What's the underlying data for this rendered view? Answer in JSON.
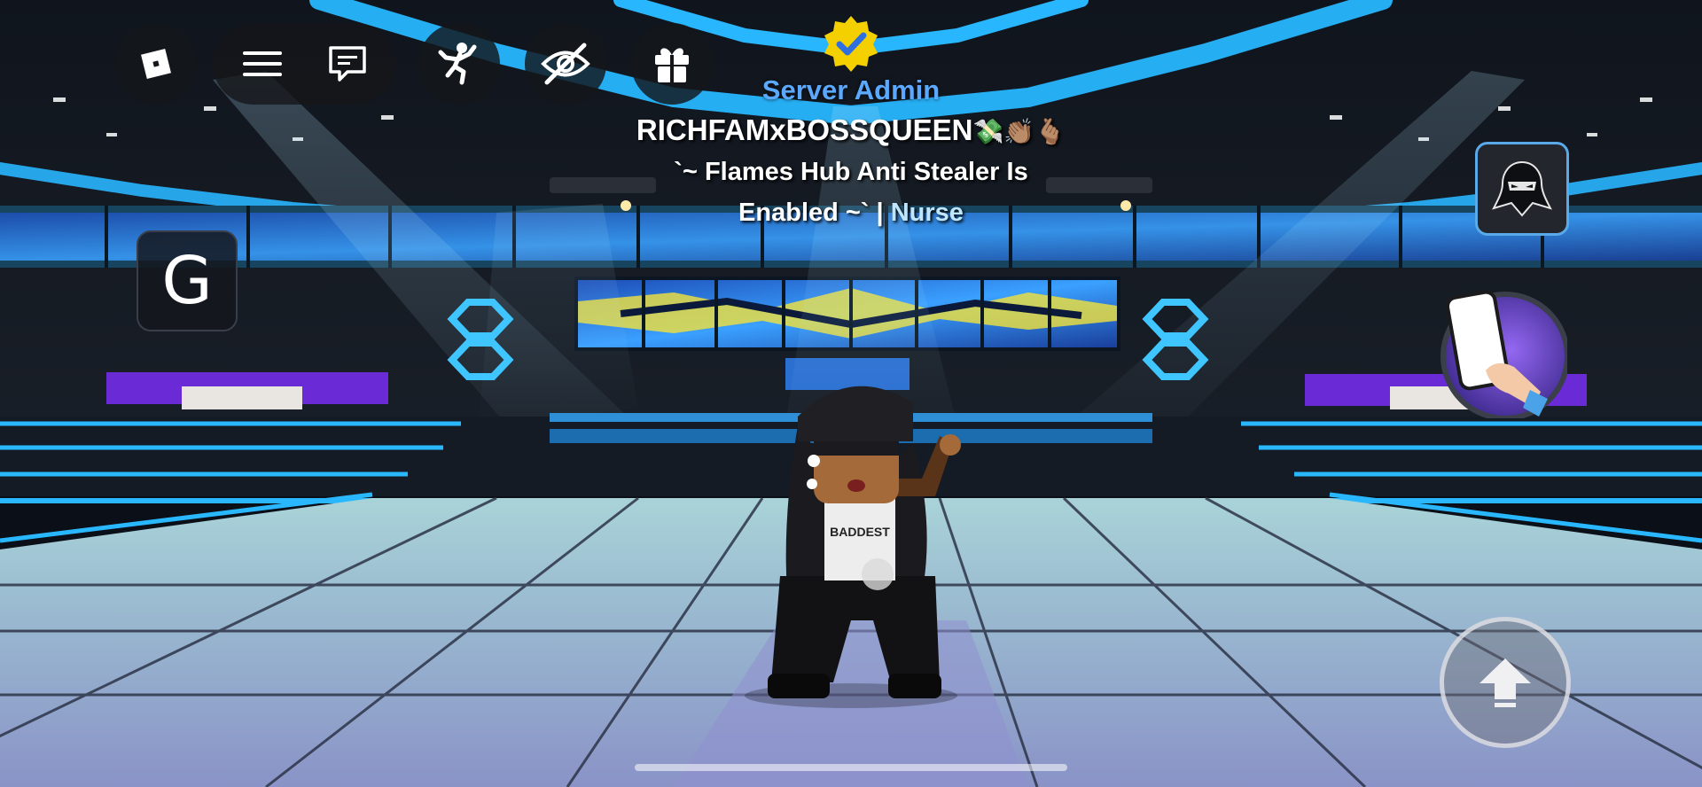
{
  "hud": {
    "roblox_menu_icon": "roblox-logo-icon",
    "hamburger_icon": "hamburger-menu-icon",
    "chat_icon": "chat-bubble-icon",
    "emote_icon": "dance-emote-icon",
    "hide_icon": "eye-slash-icon",
    "gift_icon": "gift-icon",
    "g_button_label": "G",
    "avatar_button_icon": "ninja-avatar-icon",
    "phone_button_icon": "phone-in-hand-icon",
    "jump_button_icon": "up-arrow-icon"
  },
  "nametag": {
    "rank": "Server Admin",
    "username": "RICHFAMxBOSSQUEEN",
    "username_emojis": "💸👏🏽🫰🏽",
    "bio_line1": "`~ Flames Hub Anti Stealer Is",
    "bio_line2_a": "Enabled ~` | ",
    "bio_line2_b": "Nurse",
    "verified_badge_icon": "verified-badge-icon"
  },
  "avatar_shirt_text": "BADDEST",
  "colors": {
    "neon_blue": "#28b6ff",
    "rank_blue": "#5aa9ff",
    "badge_gold": "#f5d000",
    "accent_purple": "#6a2bd6"
  }
}
